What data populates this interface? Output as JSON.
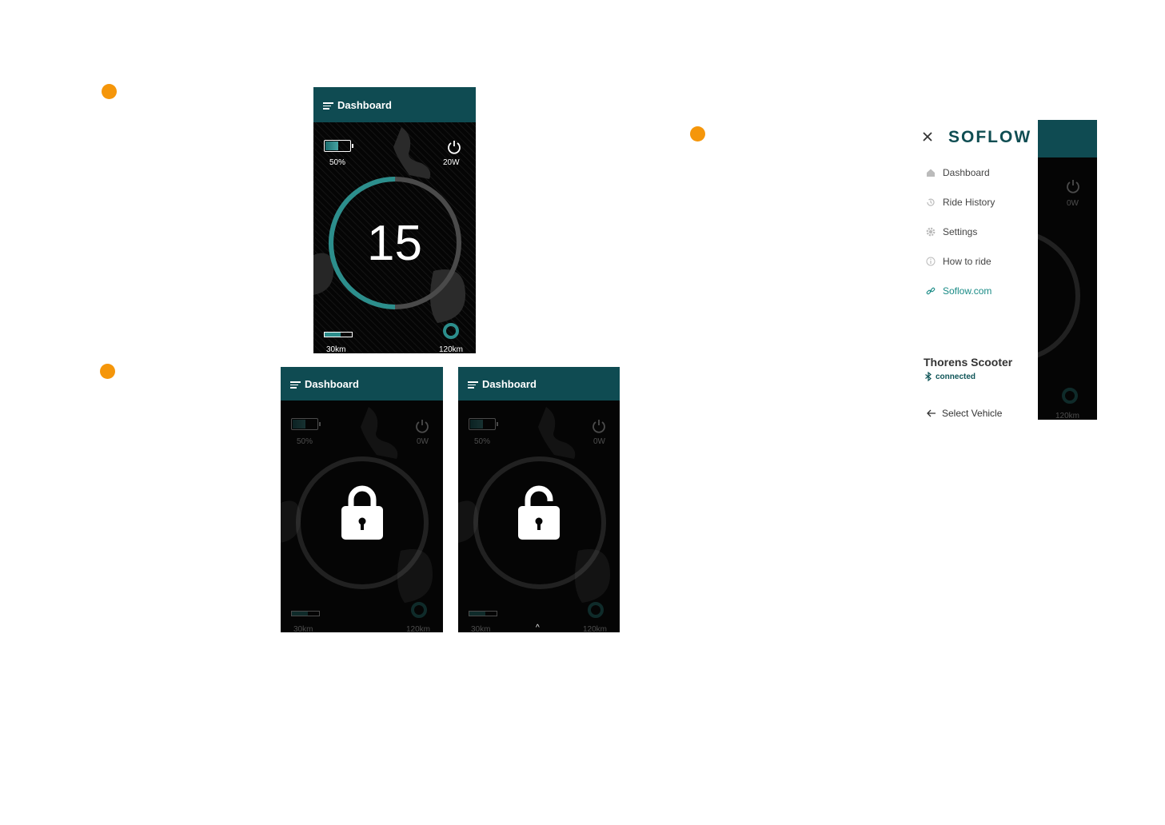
{
  "colors": {
    "accent_orange": "#f5960a",
    "header_teal": "#0f4b52",
    "gauge_teal": "#2c8e8c",
    "gauge_track": "#4a4a4a",
    "link_teal": "#1a8b86"
  },
  "screen_main": {
    "header_title": "Dashboard",
    "battery_label": "50%",
    "battery_level": 0.5,
    "power_label": "20W",
    "speed": "15",
    "gauge_level": 0.5,
    "range_label": "30km",
    "range_level": 0.6,
    "total_label": "120km"
  },
  "screen_locked": {
    "header_title": "Dashboard",
    "battery_label": "50%",
    "battery_level": 0.5,
    "power_label": "0W",
    "range_label": "30km",
    "range_level": 0.6,
    "total_label": "120km",
    "lock_state": "locked"
  },
  "screen_unlocked": {
    "header_title": "Dashboard",
    "battery_label": "50%",
    "battery_level": 0.5,
    "power_label": "0W",
    "range_label": "30km",
    "range_level": 0.6,
    "total_label": "120km",
    "lock_state": "unlocked",
    "swipe_hint": "^"
  },
  "side_menu": {
    "logo": "SOFLOW",
    "items": [
      {
        "label": "Dashboard",
        "icon": "home-icon"
      },
      {
        "label": "Ride History",
        "icon": "history-icon"
      },
      {
        "label": "Settings",
        "icon": "gear-icon"
      },
      {
        "label": "How to ride",
        "icon": "info-icon"
      },
      {
        "label": "Soflow.com",
        "icon": "link-icon"
      }
    ],
    "vehicle_name": "Thorens Scooter",
    "connection_status": "connected",
    "select_vehicle": "Select Vehicle"
  },
  "peek_screen": {
    "power_label": "0W",
    "total_label": "120km"
  }
}
